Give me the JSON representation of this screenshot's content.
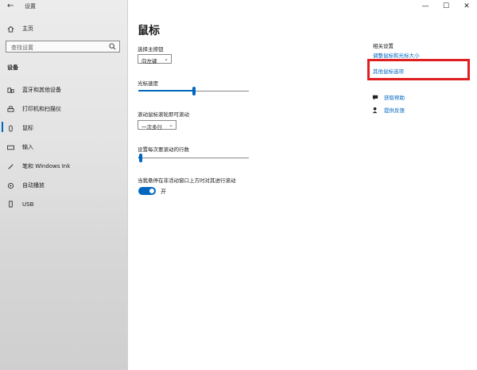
{
  "app": {
    "title": "设置",
    "back_glyph": "←"
  },
  "sidebar": {
    "home_label": "主页",
    "search_placeholder": "查找设置",
    "section_label": "设备",
    "items": [
      {
        "label": "蓝牙和其他设备",
        "icon": "bluetooth-devices-icon"
      },
      {
        "label": "打印机和扫描仪",
        "icon": "printer-icon"
      },
      {
        "label": "鼠标",
        "icon": "mouse-icon",
        "active": true
      },
      {
        "label": "输入",
        "icon": "keyboard-icon"
      },
      {
        "label": "笔和 Windows Ink",
        "icon": "pen-icon"
      },
      {
        "label": "自动播放",
        "icon": "autoplay-icon"
      },
      {
        "label": "USB",
        "icon": "usb-icon"
      }
    ]
  },
  "window_controls": {
    "minimize": "—",
    "maximize": "☐",
    "close": "✕"
  },
  "main": {
    "title": "鼠标",
    "primary_button": {
      "label": "选择主按钮",
      "value": "向左键"
    },
    "cursor_speed": {
      "label": "光标速度",
      "level": 0.5
    },
    "wheel_scroll": {
      "label": "滚动鼠标滚轮即可滚动",
      "value": "一次多行"
    },
    "lines_per_scroll": {
      "label": "设置每次要滚动的行数",
      "level": 0.02
    },
    "inactive_scroll": {
      "label": "当我悬停在非活动窗口上方时对其进行滚动",
      "state": "开",
      "on": true
    }
  },
  "related": {
    "heading": "相关设置",
    "links": [
      "调整鼠标和光标大小",
      "其他鼠标选项"
    ],
    "help": "获取帮助",
    "feedback": "提供反馈"
  },
  "colors": {
    "accent": "#0067c0",
    "highlight": "#e02020"
  }
}
